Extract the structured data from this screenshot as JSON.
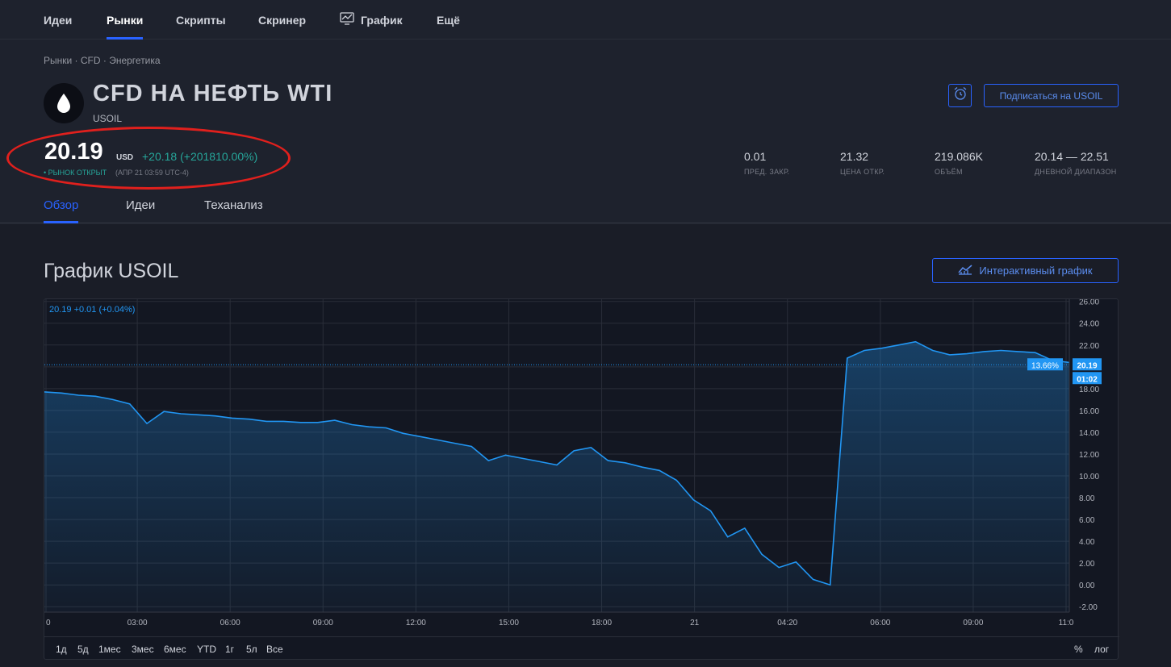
{
  "nav": {
    "items": [
      "Идеи",
      "Рынки",
      "Скрипты",
      "Скринер",
      "График",
      "Ещё"
    ],
    "active": "Рынки",
    "chart_icon": "chart-line-icon"
  },
  "header": {
    "breadcrumb": "Рынки · CFD · Энергетика",
    "logo_icon": "oil-drop-icon",
    "title": "CFD НА НЕФТЬ WTI",
    "ticker": "USOIL",
    "alert_icon": "alarm-clock-icon",
    "subscribe_label": "Подписаться на USOIL",
    "price": "20.19",
    "currency": "USD",
    "change": "+20.18 (+201810.00%)",
    "market_status": "• РЫНОК ОТКРЫТ",
    "market_time": "(АПР 21 03:59 UTC-4)",
    "highlight_color": "#e0201d",
    "stats": [
      {
        "value": "0.01",
        "label": "ПРЕД. ЗАКР."
      },
      {
        "value": "21.32",
        "label": "ЦЕНА ОТКР."
      },
      {
        "value": "219.086K",
        "label": "ОБЪЁМ"
      },
      {
        "value": "20.14 — 22.51",
        "label": "ДНЕВНОЙ ДИАПАЗОН"
      }
    ],
    "tabs": [
      "Обзор",
      "Идеи",
      "Теханализ"
    ],
    "active_tab": "Обзор"
  },
  "main": {
    "section_title": "График USOIL",
    "interactive_label": "Интерактивный график",
    "interactive_icon": "chart-icon",
    "legend": "20.19 +0.01 (+0.04%)",
    "price_label": "20.19",
    "pct_label": "13.66%",
    "countdown_label": "01:02",
    "ranges": [
      "1д",
      "5д",
      "1мес",
      "3мес",
      "6мес",
      "YTD",
      "1г",
      "5л",
      "Все"
    ],
    "scale_percent": "%",
    "scale_log": "лог",
    "colors": {
      "line": "#2196f3",
      "accent": "#2962ff",
      "positive": "#26a69a"
    }
  },
  "chart_data": {
    "type": "area",
    "title": "",
    "x_ticks": [
      "0",
      "03:00",
      "06:00",
      "09:00",
      "12:00",
      "15:00",
      "18:00",
      "21",
      "04:20",
      "06:00",
      "09:00",
      "11:0"
    ],
    "y_ticks": [
      "26.00",
      "24.00",
      "22.00",
      "20.00",
      "18.00",
      "16.00",
      "14.00",
      "12.00",
      "10.00",
      "8.00",
      "6.00",
      "4.00",
      "2.00",
      "0.00",
      "-2.00"
    ],
    "ylim": [
      -2.5,
      26.2
    ],
    "x": [
      "0",
      "00:30",
      "01:00",
      "01:30",
      "02:00",
      "02:30",
      "03:00",
      "03:30",
      "04:00",
      "04:30",
      "05:00",
      "05:30",
      "06:00",
      "06:30",
      "07:00",
      "07:30",
      "08:00",
      "08:30",
      "09:00",
      "09:30",
      "10:00",
      "10:30",
      "11:00",
      "11:30",
      "12:00",
      "12:30",
      "13:00",
      "13:30",
      "14:00",
      "14:30",
      "15:00",
      "15:30",
      "16:00",
      "16:30",
      "17:00",
      "17:30",
      "18:00",
      "18:20",
      "18:40",
      "19:00",
      "19:20",
      "19:40",
      "20:00",
      "20:15",
      "20:30",
      "20:45",
      "21:00",
      "21:10",
      "21",
      "01:00",
      "02:00",
      "03:00",
      "04:20",
      "05:00",
      "06:00",
      "07:00",
      "08:00",
      "09:00",
      "10:00",
      "10:30",
      "11:00"
    ],
    "y": [
      17.7,
      17.6,
      17.4,
      17.3,
      17.0,
      16.6,
      14.8,
      15.9,
      15.7,
      15.6,
      15.5,
      15.3,
      15.2,
      15.0,
      15.0,
      14.9,
      14.9,
      15.1,
      14.7,
      14.5,
      14.4,
      13.9,
      13.6,
      13.3,
      13.0,
      12.7,
      11.4,
      11.9,
      11.6,
      11.3,
      11.0,
      12.3,
      12.6,
      11.4,
      11.2,
      10.8,
      10.5,
      9.6,
      7.8,
      6.8,
      4.4,
      5.2,
      2.8,
      1.6,
      2.1,
      0.5,
      0.0,
      20.8,
      21.5,
      21.7,
      22.0,
      22.3,
      21.5,
      21.1,
      21.2,
      21.4,
      21.5,
      21.4,
      21.3,
      20.6,
      20.4
    ],
    "current": 20.19,
    "series": [
      {
        "values_ref": "y"
      }
    ]
  }
}
